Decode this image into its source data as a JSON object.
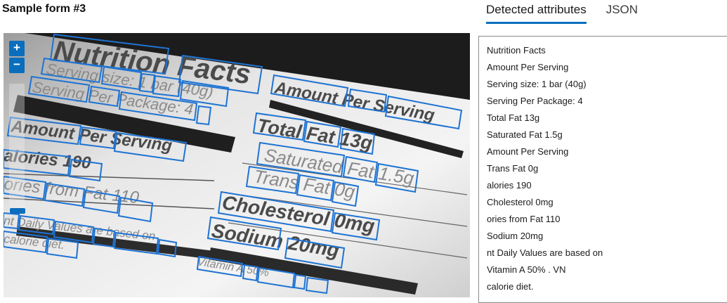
{
  "form_title": "Sample form #3",
  "tabs": [
    {
      "label": "Detected attributes",
      "active": true
    },
    {
      "label": "JSON",
      "active": false
    }
  ],
  "viewer": {
    "zoom_in": "+",
    "zoom_out": "−",
    "overlay_color": "#1e73d2",
    "label_lines": {
      "title": "Nutrition Facts",
      "serving_size": "Serving size: 1 bar (40g)",
      "serving_package": "Serving Per Package: 4",
      "amount_left": "Amount Per Serving",
      "calories": "alories 190",
      "calories_fat": "ories from Fat 110",
      "daily_values": "nt Daily Values are based on",
      "calorie_diet": "calorie diet.",
      "amount_right": "Amount Per Serving",
      "total_fat": "Total Fat 13g",
      "saturated": "Saturated Fat 1.5g",
      "trans": "Trans Fat 0g",
      "cholesterol": "Cholesterol 0mg",
      "sodium": "Sodium 20mg",
      "vitamin": "Vitamin A 50%"
    }
  },
  "attributes": [
    "Nutrition Facts",
    "Amount Per Serving",
    "Serving size: 1 bar (40g)",
    "Serving Per Package: 4",
    "Total Fat 13g",
    "Saturated Fat 1.5g",
    "Amount Per Serving",
    "Trans Fat 0g",
    "alories 190",
    "Cholesterol 0mg",
    "ories from Fat 110",
    "Sodium 20mg",
    "nt Daily Values are based on",
    "Vitamin A 50% . VN",
    "calorie diet."
  ]
}
